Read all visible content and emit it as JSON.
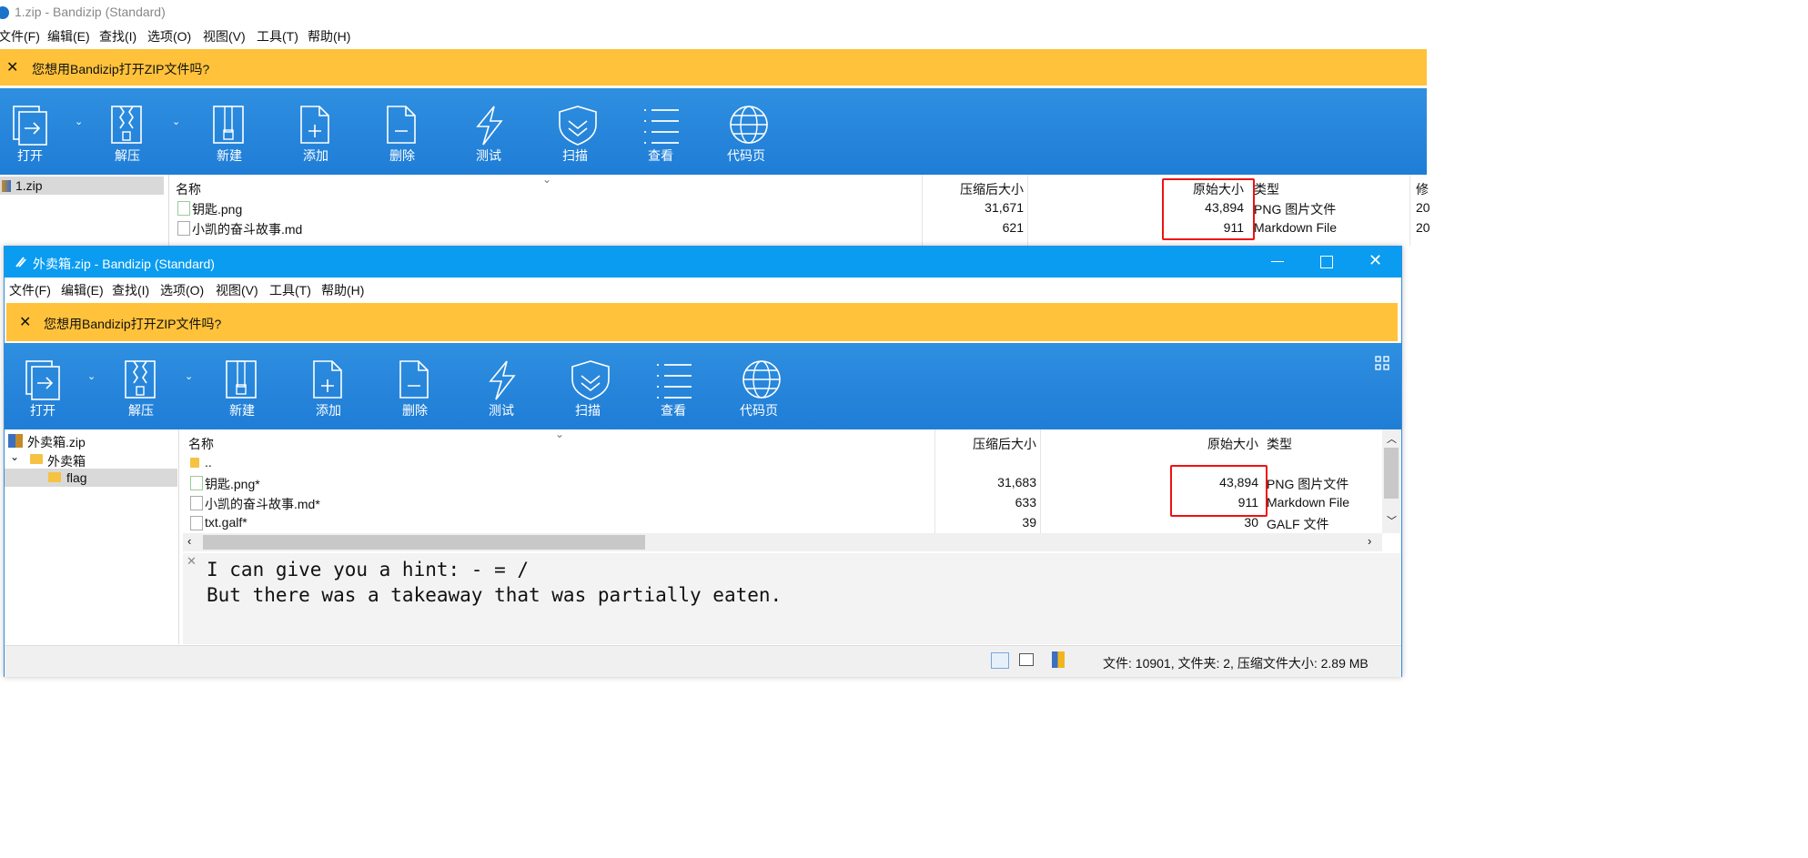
{
  "back_window": {
    "title": "1.zip - Bandizip (Standard)",
    "menu": [
      "文件(F)",
      "编辑(E)",
      "查找(I)",
      "选项(O)",
      "视图(V)",
      "工具(T)",
      "帮助(H)"
    ],
    "notice": "您想用Bandizip打开ZIP文件吗?",
    "toolbar": [
      "打开",
      "解压",
      "新建",
      "添加",
      "删除",
      "测试",
      "扫描",
      "查看",
      "代码页"
    ],
    "tree": [
      "1.zip"
    ],
    "columns": {
      "name": "名称",
      "packed": "压缩后大小",
      "original": "原始大小",
      "type": "类型",
      "modified": "修"
    },
    "rows": [
      {
        "name": "钥匙.png",
        "packed": "31,671",
        "original": "43,894",
        "type": "PNG 图片文件",
        "mod": "20"
      },
      {
        "name": "小凯的奋斗故事.md",
        "packed": "621",
        "original": "911",
        "type": "Markdown File",
        "mod": "20"
      }
    ]
  },
  "front_window": {
    "title": "外卖箱.zip - Bandizip (Standard)",
    "menu": [
      "文件(F)",
      "编辑(E)",
      "查找(I)",
      "选项(O)",
      "视图(V)",
      "工具(T)",
      "帮助(H)"
    ],
    "notice": "您想用Bandizip打开ZIP文件吗?",
    "toolbar": [
      "打开",
      "解压",
      "新建",
      "添加",
      "删除",
      "测试",
      "扫描",
      "查看",
      "代码页"
    ],
    "tree": [
      "外卖箱.zip",
      "外卖箱",
      "flag"
    ],
    "columns": {
      "name": "名称",
      "packed": "压缩后大小",
      "original": "原始大小",
      "type": "类型"
    },
    "rows": [
      {
        "name": "..",
        "packed": "",
        "original": "",
        "type": ""
      },
      {
        "name": "钥匙.png*",
        "packed": "31,683",
        "original": "43,894",
        "type": "PNG 图片文件"
      },
      {
        "name": "小凯的奋斗故事.md*",
        "packed": "633",
        "original": "911",
        "type": "Markdown File"
      },
      {
        "name": "txt.galf*",
        "packed": "39",
        "original": "30",
        "type": "GALF 文件"
      }
    ],
    "preview_lines": [
      "I can give you a hint: - = /",
      "But there was a takeaway that was partially eaten."
    ],
    "status": "文件: 10901, 文件夹: 2, 压缩文件大小: 2.89 MB"
  },
  "colors": {
    "accent": "#0a9cf0",
    "toolbar": "#1f7dd6",
    "notice": "#ffc23a",
    "highlight": "#e11111"
  }
}
